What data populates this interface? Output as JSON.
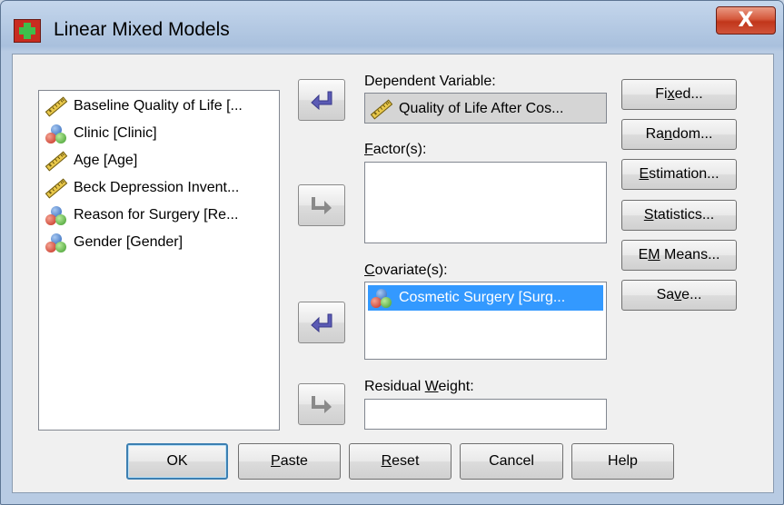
{
  "window": {
    "title": "Linear Mixed Models",
    "close_label": "X"
  },
  "variables": [
    {
      "label": "Baseline Quality of Life [...",
      "icon": "scale-ruler-icon"
    },
    {
      "label": "Clinic [Clinic]",
      "icon": "nominal-balls-icon"
    },
    {
      "label": "Age [Age]",
      "icon": "scale-ruler-icon"
    },
    {
      "label": "Beck Depression Invent...",
      "icon": "scale-ruler-icon"
    },
    {
      "label": "Reason for Surgery [Re...",
      "icon": "nominal-balls-icon"
    },
    {
      "label": "Gender [Gender]",
      "icon": "nominal-balls-icon"
    }
  ],
  "fields": {
    "dependent": {
      "label": "Dependent Variable:",
      "value": "Quality of Life After Cos..."
    },
    "factors": {
      "label_pre": "",
      "label_key": "F",
      "label_post": "actor(s):"
    },
    "covariates": {
      "label_pre": "",
      "label_key": "C",
      "label_post": "ovariate(s):",
      "items": [
        "Cosmetic Surgery [Surg..."
      ]
    },
    "residual": {
      "label_pre": "Residual ",
      "label_key": "W",
      "label_post": "eight:"
    }
  },
  "side_buttons": [
    {
      "pre": "Fi",
      "key": "x",
      "post": "ed..."
    },
    {
      "pre": "Ra",
      "key": "n",
      "post": "dom..."
    },
    {
      "pre": "",
      "key": "E",
      "post": "stimation..."
    },
    {
      "pre": "",
      "key": "S",
      "post": "tatistics..."
    },
    {
      "pre": "E",
      "key": "M",
      "post": " Means..."
    },
    {
      "pre": "Sa",
      "key": "v",
      "post": "e..."
    }
  ],
  "bottom_buttons": [
    {
      "pre": "",
      "key": "",
      "post": "OK"
    },
    {
      "pre": "",
      "key": "P",
      "post": "aste"
    },
    {
      "pre": "",
      "key": "R",
      "post": "eset"
    },
    {
      "pre": "",
      "key": "",
      "post": "Cancel"
    },
    {
      "pre": "",
      "key": "",
      "post": "Help"
    }
  ],
  "colors": {
    "accent": "#5b5bb5",
    "arrow_disabled": "#808080",
    "selection": "#3399ff"
  }
}
